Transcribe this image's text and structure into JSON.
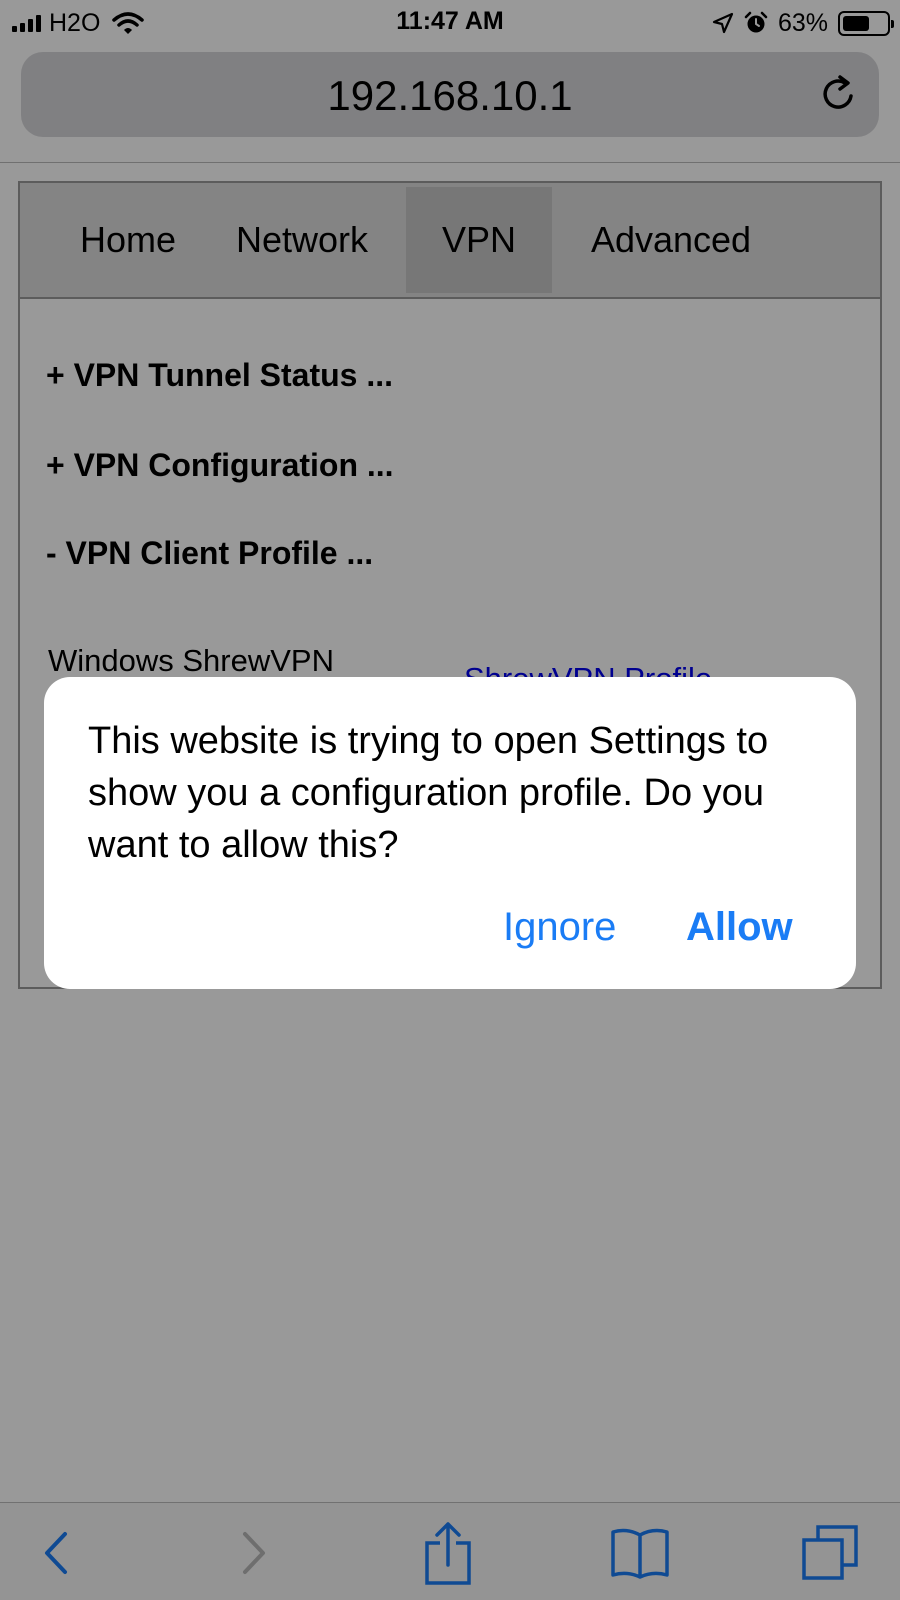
{
  "status_bar": {
    "carrier": "H2O",
    "time": "11:47 AM",
    "battery_percent": "63%",
    "battery_level": 0.63
  },
  "browser": {
    "url": "192.168.10.1"
  },
  "page": {
    "nav_tabs": [
      {
        "label": "Home"
      },
      {
        "label": "Network"
      },
      {
        "label": "VPN",
        "active": true
      },
      {
        "label": "Advanced"
      }
    ],
    "sections": [
      {
        "label": "+ VPN Tunnel Status ..."
      },
      {
        "label": "+ VPN Configuration ..."
      },
      {
        "label": "- VPN Client Profile ..."
      }
    ],
    "profile_name": "Windows ShrewVPN",
    "profile_link": "ShrewVPN Profile"
  },
  "alert": {
    "message": "This website is trying to open Settings to show you a configuration profile. Do you want to allow this?",
    "ignore_label": "Ignore",
    "allow_label": "Allow"
  },
  "colors": {
    "accent": "#1a7cf5",
    "link": "#0000ee",
    "nav_active": "#c7c7c7"
  },
  "icons": [
    "cellular-signal-icon",
    "wifi-icon",
    "location-arrow-icon",
    "alarm-icon",
    "battery-icon",
    "reload-icon",
    "back-icon",
    "forward-icon",
    "share-icon",
    "bookmarks-icon",
    "tabs-icon"
  ]
}
